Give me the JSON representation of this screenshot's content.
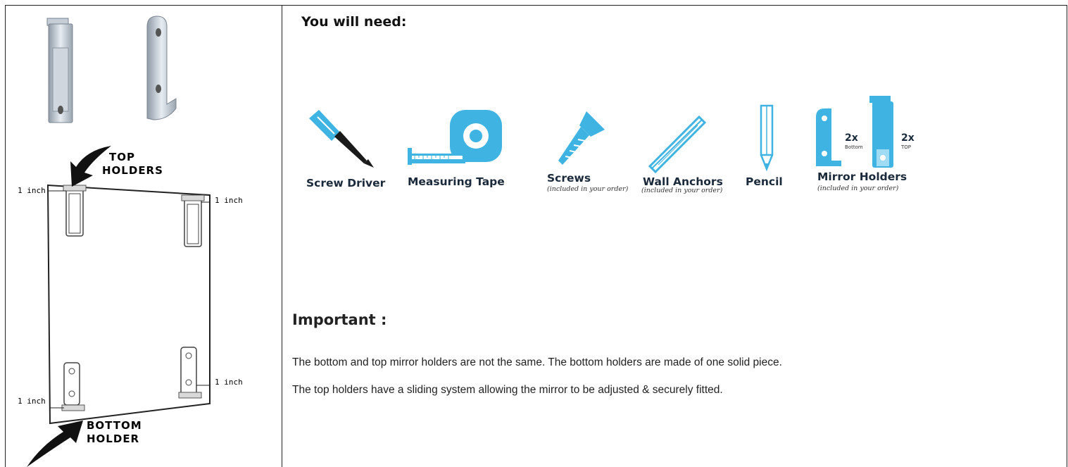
{
  "left_panel": {
    "top_label_line1": "TOP",
    "top_label_line2": "HOLDERS",
    "bottom_label_line1": "BOTTOM",
    "bottom_label_line2": "HOLDER",
    "measure_top_left": "1 inch",
    "measure_top_right": "1 inch",
    "measure_bottom_left": "1 inch",
    "measure_bottom_right": "1 inch"
  },
  "right_panel": {
    "need_title": "You will need:",
    "tools": [
      {
        "label": "Screw Driver",
        "sub": "",
        "icon": "screwdriver-icon"
      },
      {
        "label": "Measuring Tape",
        "sub": "",
        "icon": "measuring-tape-icon"
      },
      {
        "label": "Screws",
        "sub": "(included in your order)",
        "icon": "screw-icon"
      },
      {
        "label": "Wall Anchors",
        "sub": "(included in your order)",
        "icon": "wall-anchor-icon"
      },
      {
        "label": "Pencil",
        "sub": "",
        "icon": "pencil-icon"
      },
      {
        "label": "Mirror Holders",
        "sub": "(included in your order)",
        "icon": "mirror-holders-icon"
      }
    ],
    "holders": {
      "bottom_qty": "2x",
      "bottom_label": "Bottom",
      "top_qty": "2x",
      "top_label": "TOP"
    },
    "important_title": "Important :",
    "paragraphs": [
      "The bottom and top mirror holders are not the same. The bottom holders are made of one solid piece.",
      "The top holders have a sliding system allowing the mirror to be adjusted & securely fitted."
    ]
  },
  "colors": {
    "icon_blue": "#3fb4e3",
    "border": "#222222"
  }
}
